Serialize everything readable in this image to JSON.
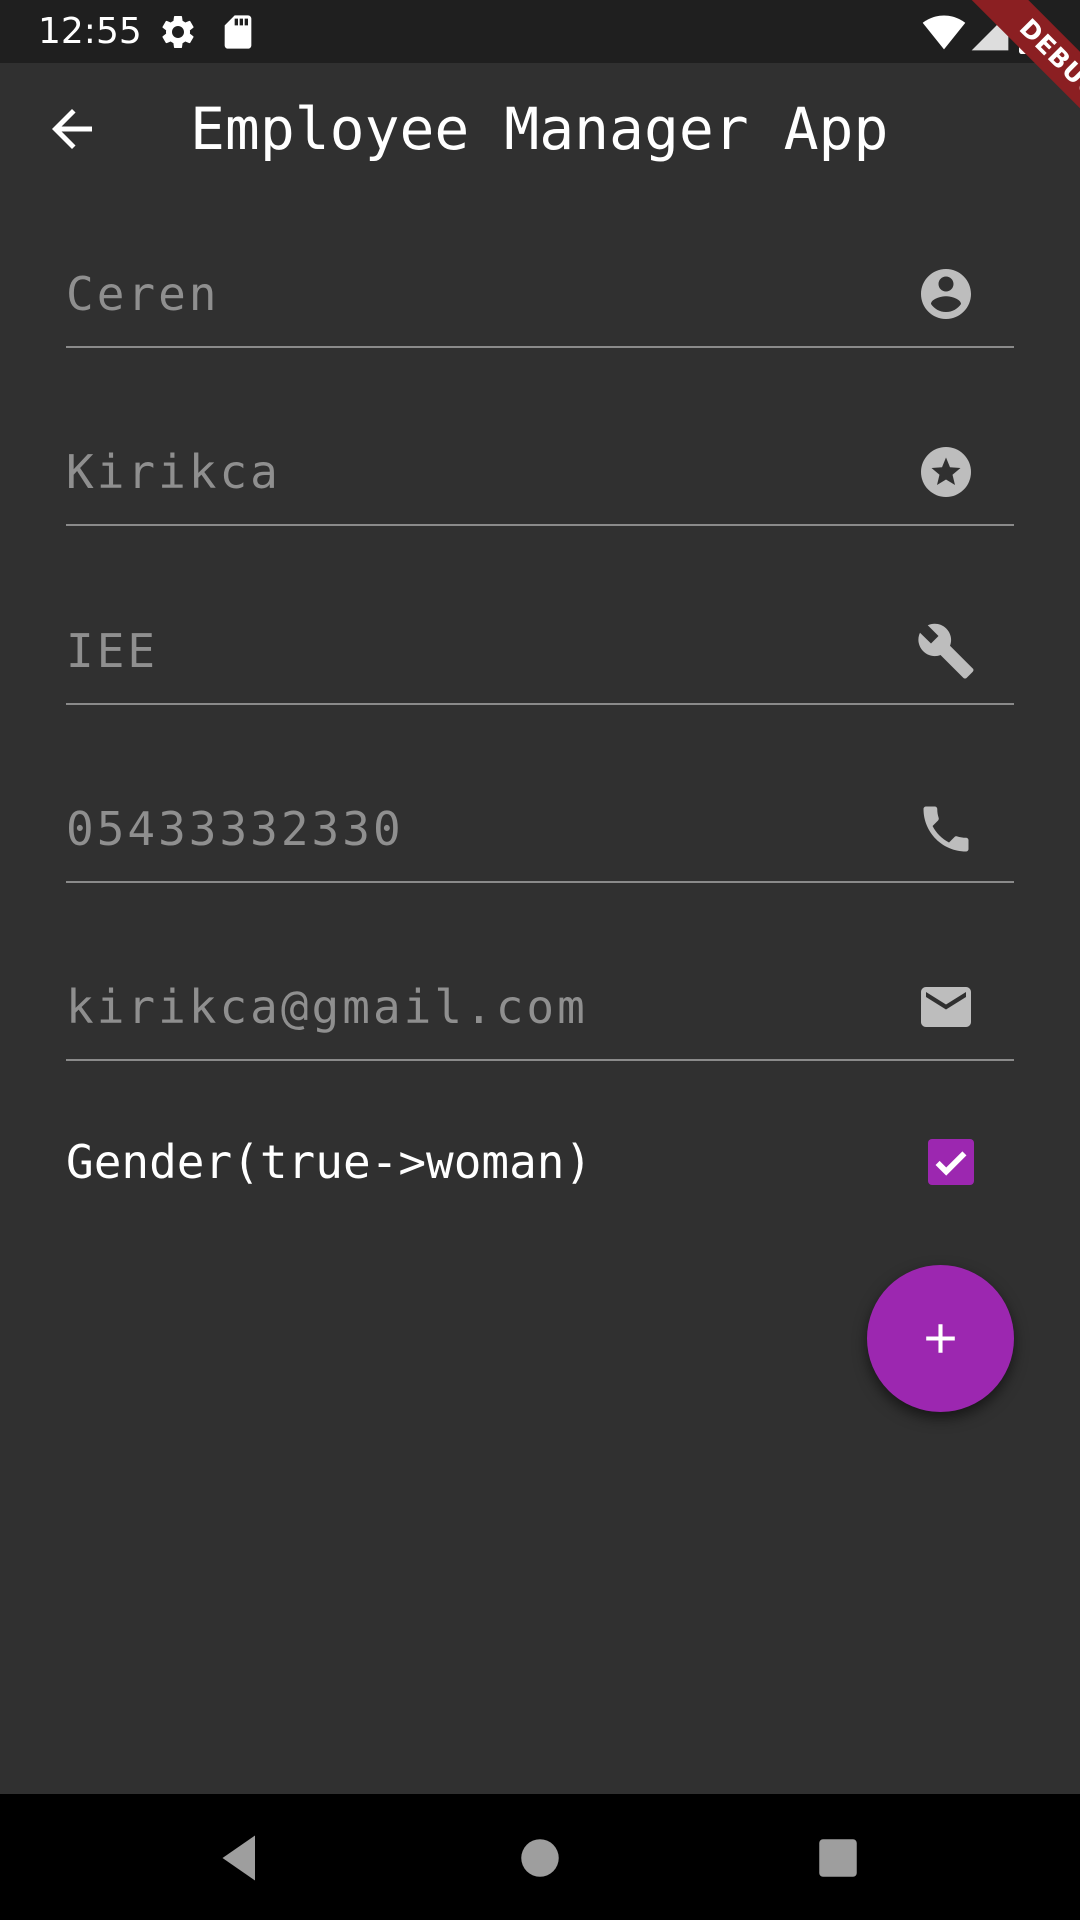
{
  "status_bar": {
    "time": "12:55",
    "icons": [
      "settings-icon",
      "sd-card-icon",
      "wifi-icon",
      "cell-signal-icon",
      "battery-icon"
    ]
  },
  "debug_banner": {
    "label": "DEBUG"
  },
  "app_bar": {
    "title": "Employee Manager App",
    "back_icon": "arrow-back-icon"
  },
  "form": {
    "fields": [
      {
        "value": "Ceren",
        "icon": "account-circle-icon"
      },
      {
        "value": "Kirikca",
        "icon": "star-badge-icon"
      },
      {
        "value": "IEE",
        "icon": "wrench-icon"
      },
      {
        "value": "05433332330",
        "icon": "phone-icon"
      },
      {
        "value": "kirikca@gmail.com",
        "icon": "mail-icon"
      }
    ],
    "gender": {
      "label": "Gender(true->woman)",
      "checked": true
    }
  },
  "fab": {
    "icon": "add-icon"
  },
  "nav": {
    "items": [
      "back-nav-icon",
      "home-nav-icon",
      "recents-nav-icon"
    ]
  },
  "colors": {
    "background": "#303030",
    "status_bar": "#1f1f1f",
    "accent": "#9c27b0",
    "field_text": "#8f8f8f",
    "debug_banner": "#8b1f22"
  }
}
